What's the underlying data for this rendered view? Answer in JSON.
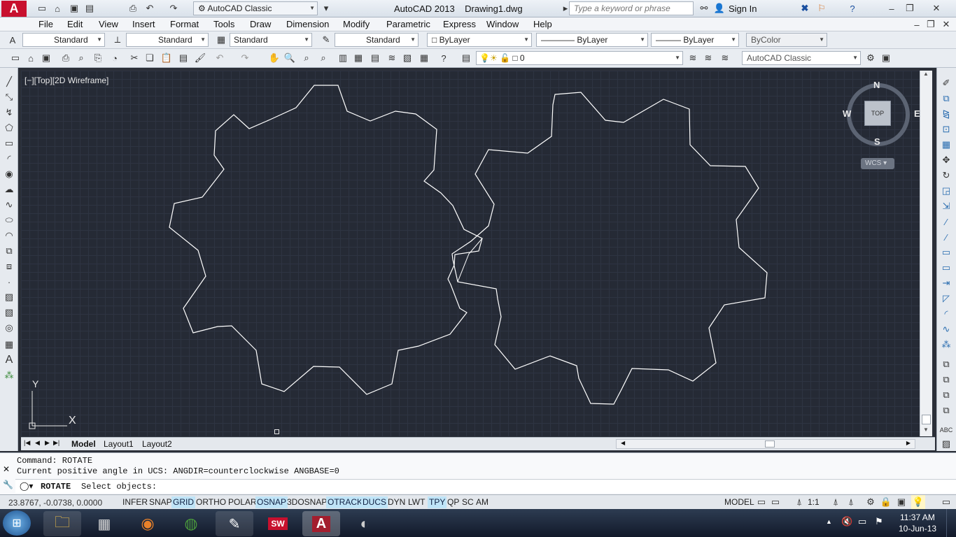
{
  "title_bar": {
    "workspace": "AutoCAD Classic",
    "title": "AutoCAD 2013    Drawing1.dwg",
    "search_placeholder": "Type a keyword or phrase",
    "sign_in": "Sign In"
  },
  "menu": [
    "File",
    "Edit",
    "View",
    "Insert",
    "Format",
    "Tools",
    "Draw",
    "Dimension",
    "Modify",
    "Parametric",
    "Window",
    "Express",
    "Help"
  ],
  "styles_toolbar": {
    "text_style": "Standard",
    "dim_style": "Standard",
    "table_style": "Standard",
    "mleader_style": "Standard",
    "layer_color": "ByLayer",
    "linetype": "ByLayer",
    "lineweight": "ByLayer",
    "plot_style": "ByColor"
  },
  "layers_toolbar": {
    "layer": "0",
    "workspace": "AutoCAD Classic"
  },
  "viewport_label": "[−][Top][2D Wireframe]",
  "viewcube": {
    "north": "N",
    "south": "S",
    "east": "E",
    "west": "W",
    "face": "TOP",
    "wcs": "WCS"
  },
  "ucs": {
    "x": "X",
    "y": "Y"
  },
  "layout_tabs": [
    "Model",
    "Layout1",
    "Layout2"
  ],
  "command": {
    "line1": "Command: ROTATE",
    "line2": "Current positive angle in UCS:  ANGDIR=counterclockwise  ANGBASE=0",
    "prompt_cmd": "ROTATE",
    "prompt_text": "Select objects:"
  },
  "status": {
    "coords": "23.8767, -0.0738, 0.0000",
    "toggles": [
      {
        "label": "INFER",
        "on": false
      },
      {
        "label": "SNAP",
        "on": false
      },
      {
        "label": "GRID",
        "on": true
      },
      {
        "label": "ORTHO",
        "on": false
      },
      {
        "label": "POLAR",
        "on": false
      },
      {
        "label": "OSNAP",
        "on": true
      },
      {
        "label": "3DOSNAP",
        "on": false
      },
      {
        "label": "OTRACK",
        "on": true
      },
      {
        "label": "DUCS",
        "on": true
      },
      {
        "label": "DYN",
        "on": false
      },
      {
        "label": "LWT",
        "on": false
      },
      {
        "label": "TPY",
        "on": true
      },
      {
        "label": "QP",
        "on": false
      },
      {
        "label": "SC",
        "on": false
      },
      {
        "label": "AM",
        "on": false
      }
    ],
    "model": "MODEL",
    "scale": "1:1"
  },
  "taskbar": {
    "time": "11:37 AM",
    "date": "10-Jun-13",
    "apps": [
      "windows-start",
      "file-explorer",
      "calculator",
      "firefox",
      "chrome",
      "paint",
      "solidworks",
      "autocad",
      "app"
    ]
  },
  "colors": {
    "canvas": "#252a35",
    "geometry": "#ffffff",
    "toggle_on": "#bfe4f7"
  }
}
